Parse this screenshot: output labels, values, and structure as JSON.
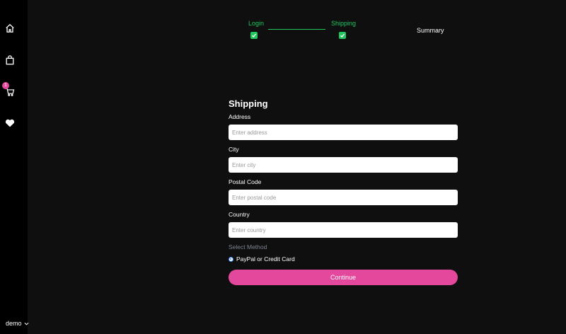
{
  "sidebar": {
    "items": [
      {
        "icon": "home-icon"
      },
      {
        "icon": "shopping-bag-icon"
      },
      {
        "icon": "cart-icon",
        "badge": "1"
      },
      {
        "icon": "heart-icon"
      }
    ],
    "user": {
      "label": "demo",
      "icon": "chevron-down-icon"
    }
  },
  "steps": [
    {
      "label": "Login",
      "complete": true
    },
    {
      "label": "Shipping",
      "complete": true
    },
    {
      "label": "Summary",
      "complete": false
    }
  ],
  "colors": {
    "accent": "#e4489d",
    "complete": "#22c55e"
  },
  "form": {
    "title": "Shipping",
    "fields": [
      {
        "label": "Address",
        "value": "",
        "placeholder": "Enter address"
      },
      {
        "label": "City",
        "value": "",
        "placeholder": "Enter city"
      },
      {
        "label": "Postal Code",
        "value": "",
        "placeholder": "Enter postal code"
      },
      {
        "label": "Country",
        "value": "",
        "placeholder": "Enter country"
      }
    ],
    "method_label": "Select Method",
    "method_option": "PayPal or Credit Card",
    "submit_label": "Continue"
  }
}
